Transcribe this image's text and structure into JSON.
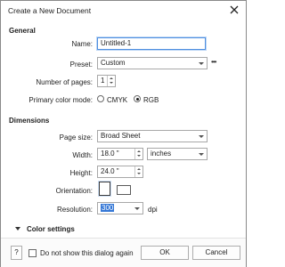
{
  "window": {
    "title": "Create a New Document"
  },
  "general": {
    "heading": "General",
    "name_label": "Name:",
    "name_value": "Untitled-1",
    "preset_label": "Preset:",
    "preset_value": "Custom",
    "preset_more": "•••",
    "pages_label": "Number of pages:",
    "pages_value": "1",
    "color_mode_label": "Primary color mode:",
    "color_modes": [
      "CMYK",
      "RGB"
    ],
    "color_mode_selected": "RGB"
  },
  "dimensions": {
    "heading": "Dimensions",
    "page_size_label": "Page size:",
    "page_size_value": "Broad Sheet",
    "width_label": "Width:",
    "width_value": "18.0 \"",
    "units_value": "inches",
    "height_label": "Height:",
    "height_value": "24.0 \"",
    "orientation_label": "Orientation:",
    "orientation_selected": "portrait",
    "resolution_label": "Resolution:",
    "resolution_value": "300",
    "resolution_unit": "dpi"
  },
  "color_settings": {
    "label": "Color settings"
  },
  "footer": {
    "help_label": "?",
    "dont_show_label": "Do not show this dialog again",
    "ok_label": "OK",
    "cancel_label": "Cancel"
  },
  "colors": {
    "accent": "#3477d6",
    "focus_border": "#4f8fe0"
  }
}
